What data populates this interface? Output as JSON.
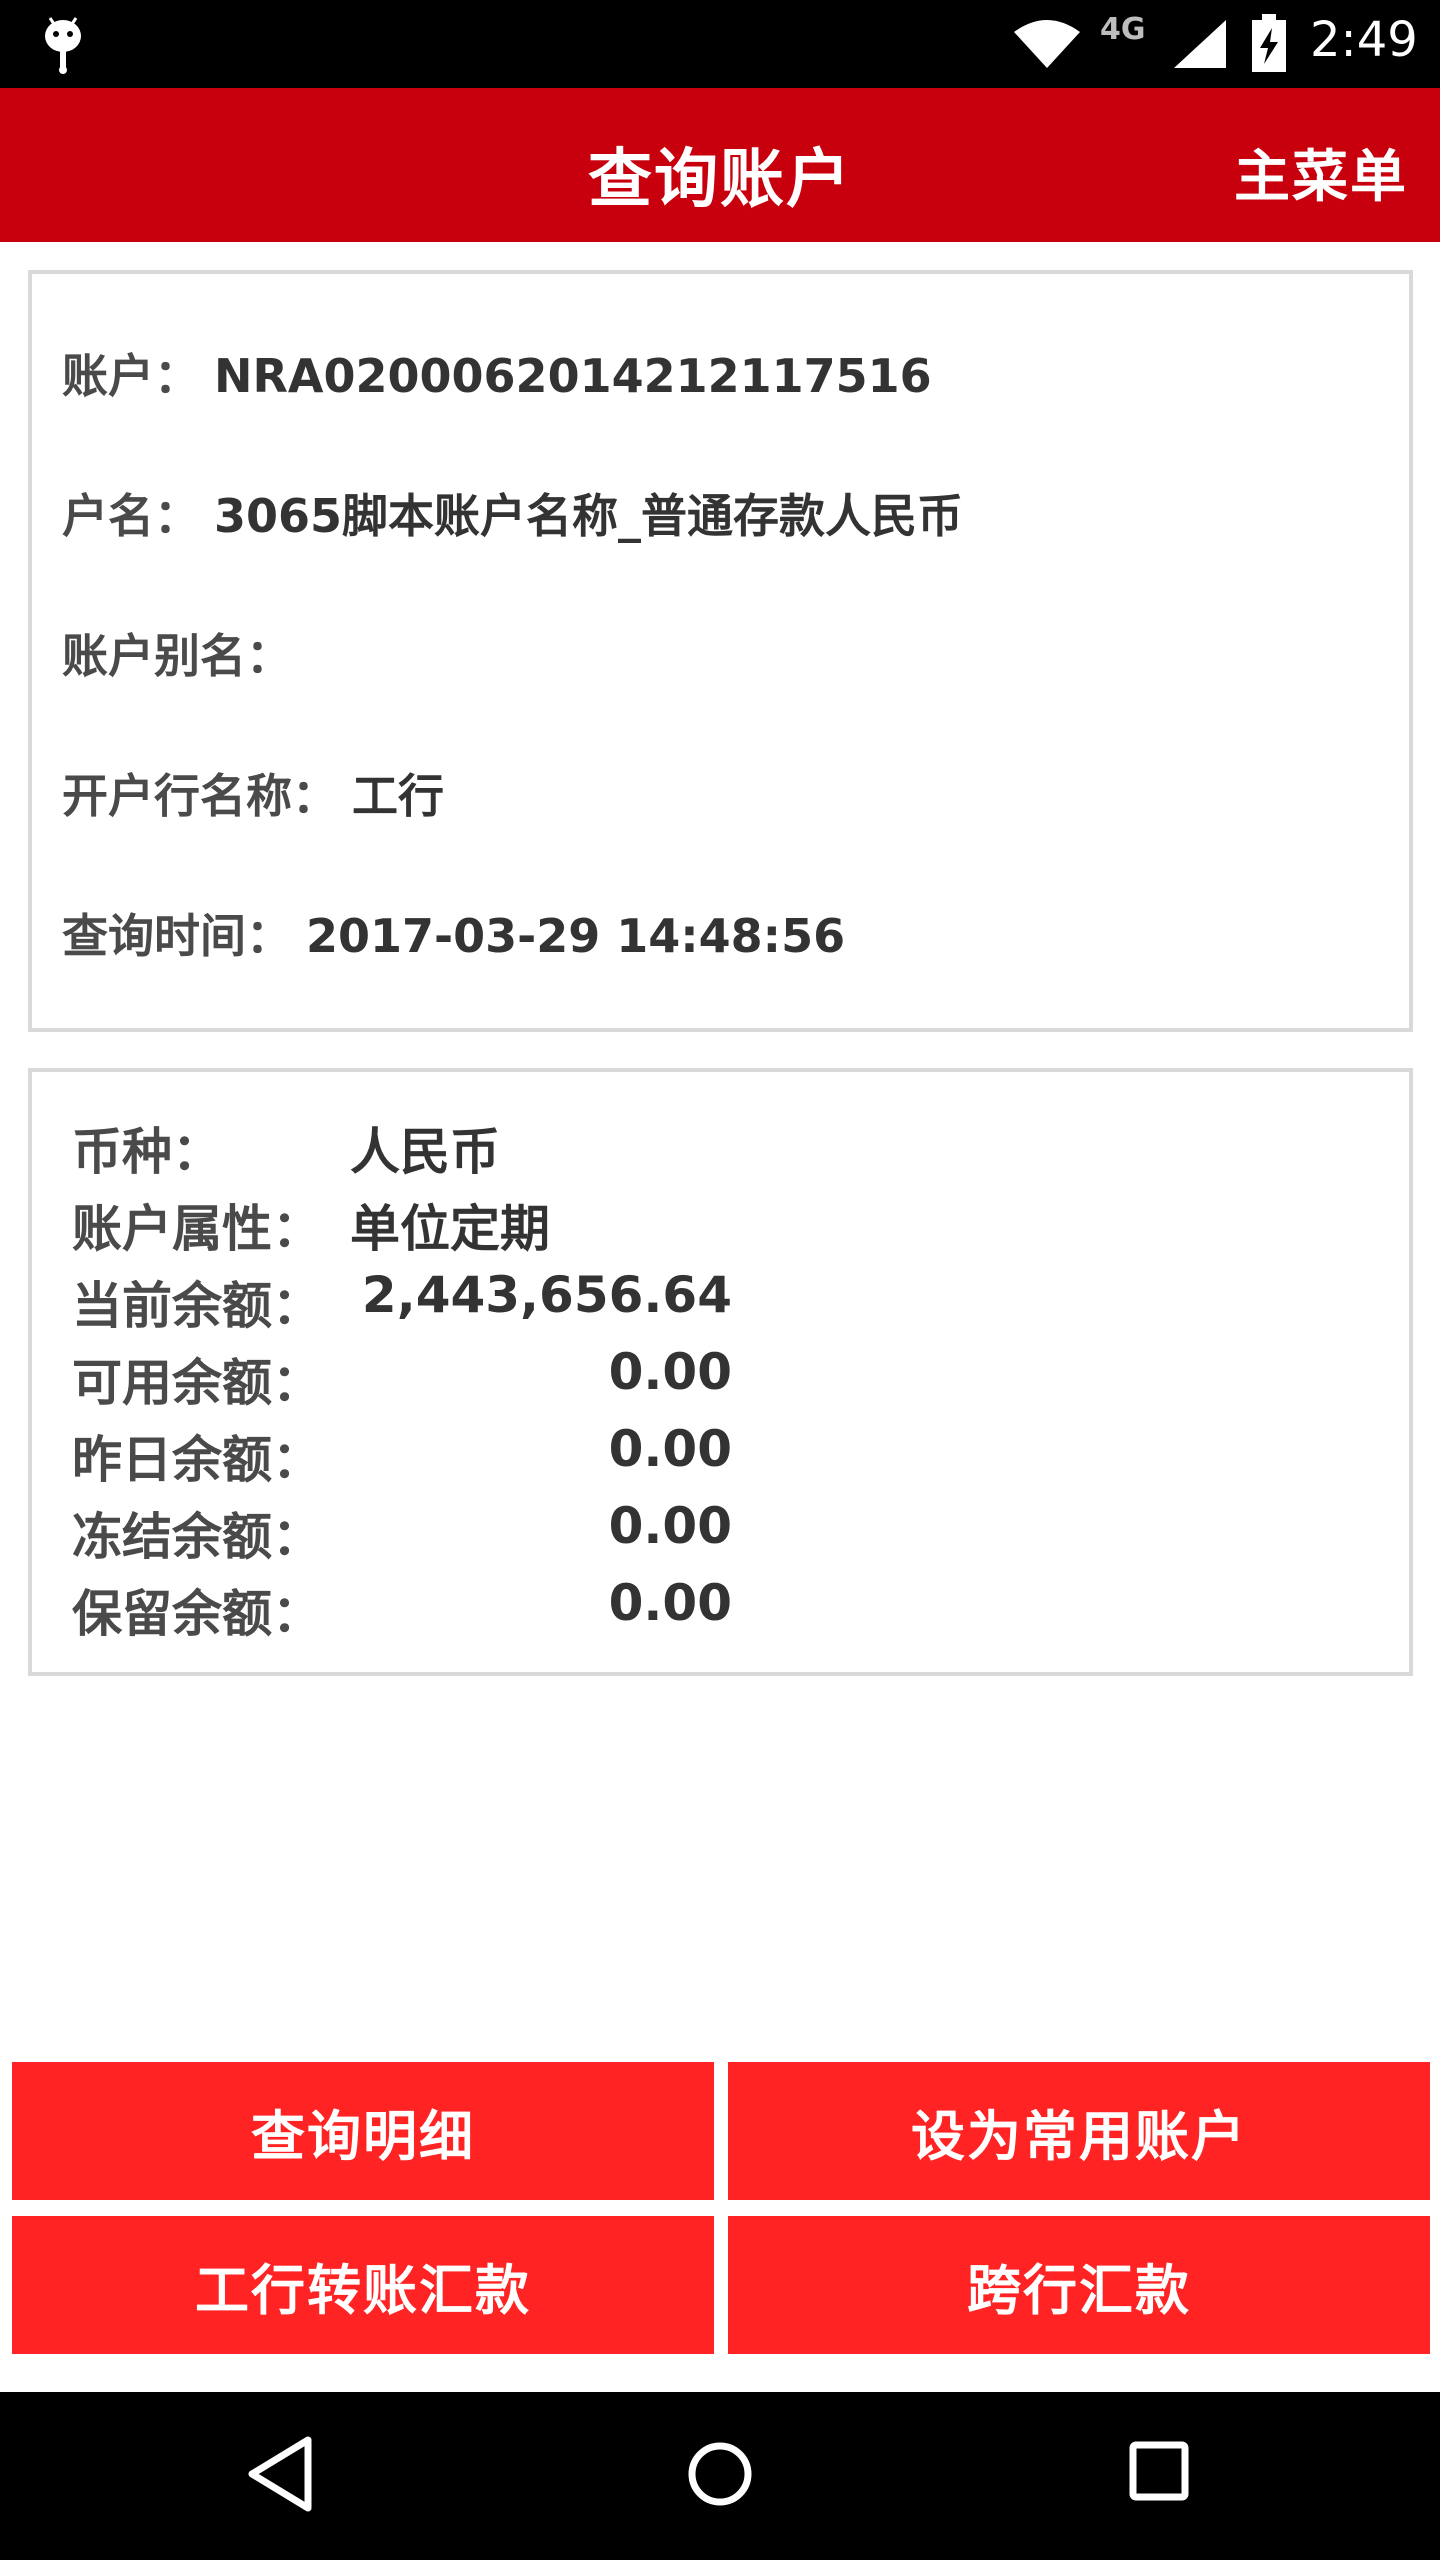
{
  "status_bar": {
    "network": "4G",
    "time": "2:49"
  },
  "header": {
    "title": "查询账户",
    "menu": "主菜单"
  },
  "account_info": {
    "account": {
      "label": "账户：",
      "value": "NRA0200062014212117516"
    },
    "name": {
      "label": "户名：",
      "value": "3065脚本账户名称_普通存款人民币"
    },
    "alias": {
      "label": "账户别名：",
      "value": ""
    },
    "bank": {
      "label": "开户行名称：",
      "value": "工行"
    },
    "query_time": {
      "label": "查询时间：",
      "value": "2017-03-29 14:48:56"
    }
  },
  "balance_info": {
    "currency": {
      "label": "币种：",
      "value": "人民币"
    },
    "attribute": {
      "label": "账户属性：",
      "value": "单位定期"
    },
    "current": {
      "label": "当前余额：",
      "value": "2,443,656.64"
    },
    "available": {
      "label": "可用余额：",
      "value": "0.00"
    },
    "yesterday": {
      "label": "昨日余额：",
      "value": "0.00"
    },
    "frozen": {
      "label": "冻结余额：",
      "value": "0.00"
    },
    "reserved": {
      "label": "保留余额：",
      "value": "0.00"
    }
  },
  "actions": {
    "query_detail": "查询明细",
    "set_common": "设为常用账户",
    "icbc_transfer": "工行转账汇款",
    "interbank": "跨行汇款"
  },
  "colors": {
    "header_red": "#c8000e",
    "button_red": "#ff2323",
    "border_gray": "#d9d9d9"
  },
  "icons": {
    "status": [
      "android-icon",
      "wifi-icon",
      "signal-icon",
      "battery-charging-icon"
    ],
    "nav": [
      "back-icon",
      "home-icon",
      "recent-apps-icon"
    ]
  }
}
